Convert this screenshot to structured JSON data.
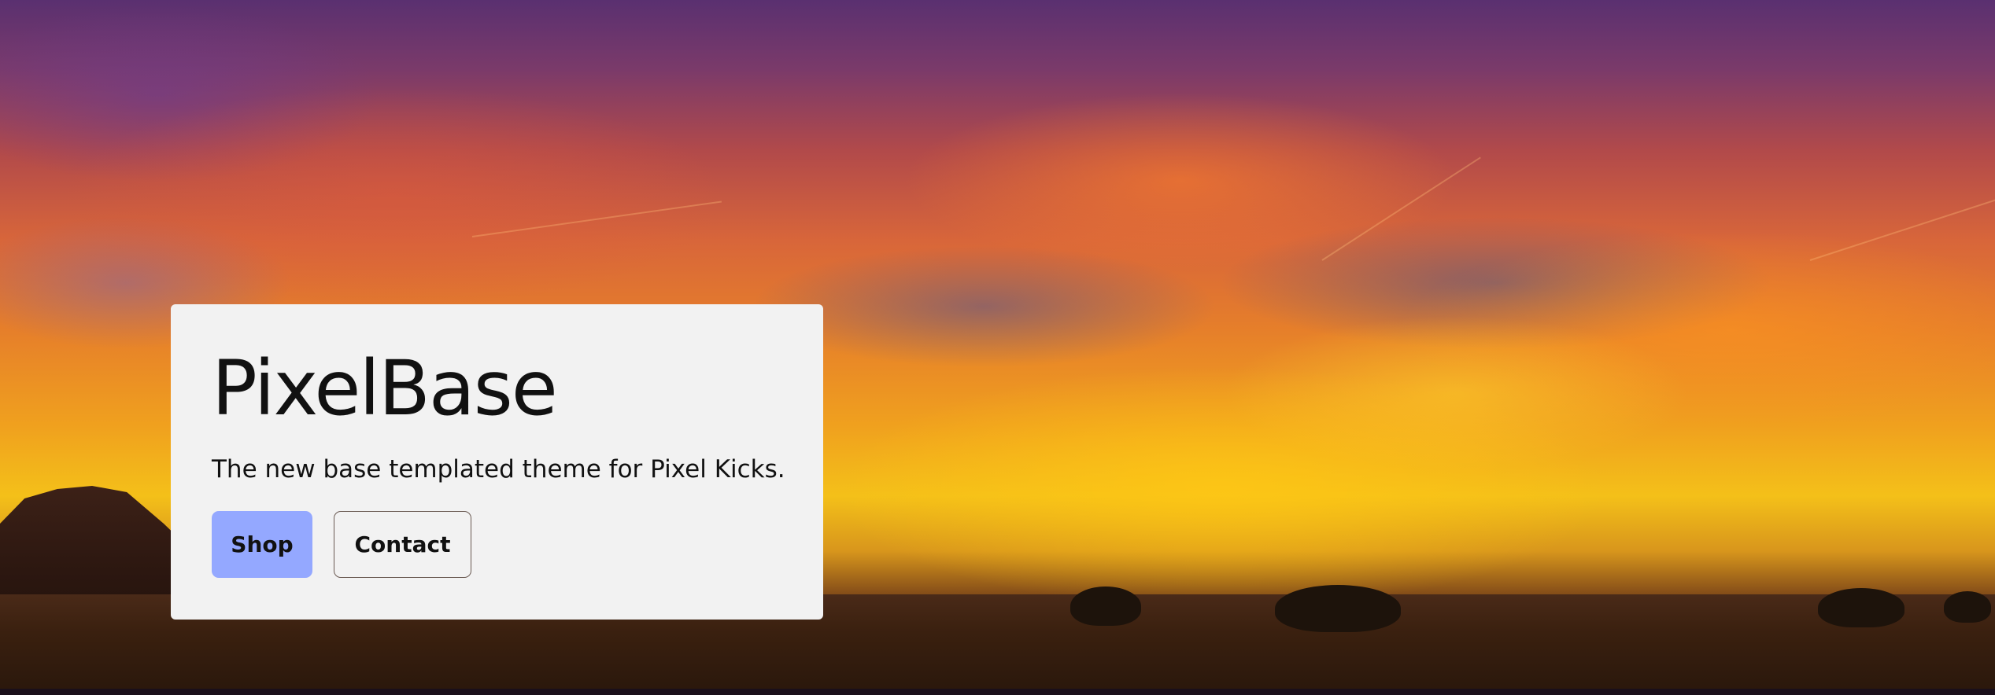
{
  "hero": {
    "title": "PixelBase",
    "tagline": "The new base templated theme for Pixel Kicks.",
    "buttons": {
      "shop_label": "Shop",
      "contact_label": "Contact"
    }
  },
  "colors": {
    "card_background": "#f2f2f2",
    "shop_button": "#94a8ff",
    "text": "#111111"
  }
}
